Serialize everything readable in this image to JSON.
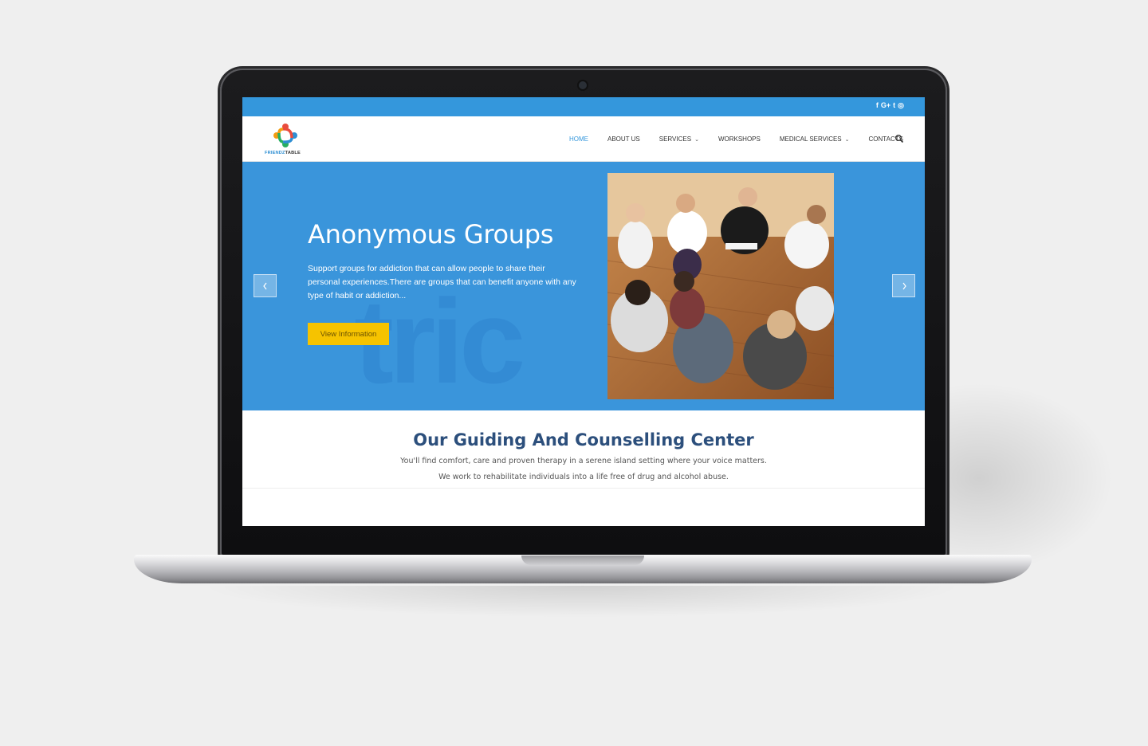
{
  "social": {
    "icons": [
      "facebook-icon",
      "google-plus-icon",
      "twitter-icon",
      "instagram-icon"
    ],
    "labels": [
      "f",
      "G+",
      "t",
      "◎"
    ]
  },
  "logo": {
    "text_a": "FRIENDZ",
    "text_b": "TABLE"
  },
  "nav": {
    "items": [
      {
        "label": "HOME",
        "active": true
      },
      {
        "label": "ABOUT US"
      },
      {
        "label": "SERVICES",
        "dropdown": true
      },
      {
        "label": "WORKSHOPS"
      },
      {
        "label": "MEDICAL SERVICES",
        "dropdown": true
      },
      {
        "label": "CONTACTS"
      }
    ]
  },
  "hero": {
    "title": "Anonymous Groups",
    "text": "Support groups for addiction that can allow people to share their personal experiences.There are groups that can benefit anyone with any type of habit or addiction...",
    "button_label": "View Information",
    "prev_arrow": "‹",
    "next_arrow": "›"
  },
  "guide": {
    "title": "Our Guiding And Counselling Center",
    "line1": "You'll find comfort, care and proven therapy in a serene island setting where your voice matters.",
    "line2": "We work to rehabilitate individuals into a life free of drug and alcohol abuse."
  },
  "colors": {
    "accent": "#3497dc",
    "hero_bg": "#3a95db",
    "button": "#f6c300",
    "guide_title": "#2c4f7c"
  }
}
